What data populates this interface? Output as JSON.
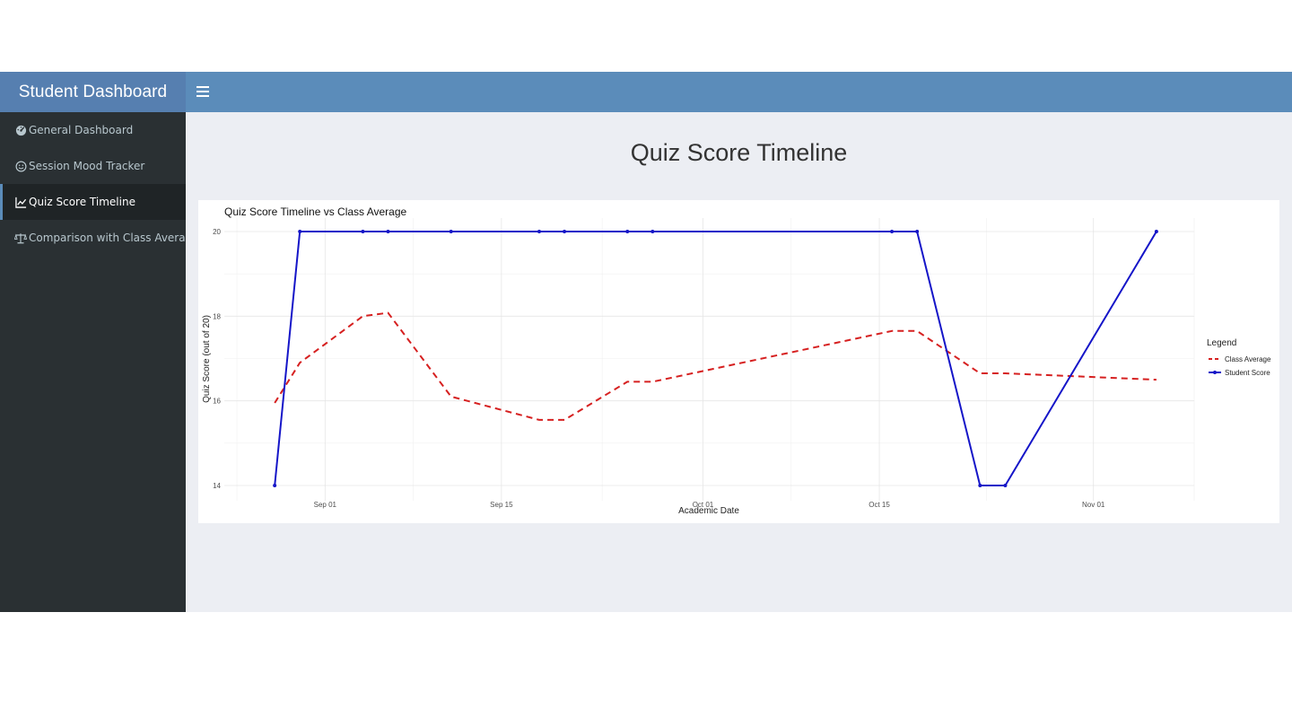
{
  "app": {
    "brand": "Student Dashboard",
    "header_color": "#5b8cba",
    "sidebar_color": "#2a3033"
  },
  "sidebar": {
    "items": [
      {
        "label": "General Dashboard",
        "icon": "tachometer-icon",
        "active": false
      },
      {
        "label": "Session Mood Tracker",
        "icon": "smile-icon",
        "active": false
      },
      {
        "label": "Quiz Score Timeline",
        "icon": "line-chart-icon",
        "active": true
      },
      {
        "label": "Comparison with Class Average",
        "icon": "balance-scale-icon",
        "active": false
      }
    ]
  },
  "main": {
    "page_title": "Quiz Score Timeline"
  },
  "chart_data": {
    "type": "line",
    "title": "Quiz Score Timeline vs Class Average",
    "xlabel": "Academic Date",
    "ylabel": "Quiz Score (out of 20)",
    "ylim": [
      14,
      20
    ],
    "xlim": [
      "2025-08-24",
      "2025-11-09"
    ],
    "y_ticks": [
      14,
      16,
      18,
      20
    ],
    "x_ticks": [
      {
        "date": "2025-09-01",
        "label": "Sep 01"
      },
      {
        "date": "2025-09-15",
        "label": "Sep 15"
      },
      {
        "date": "2025-10-01",
        "label": "Oct 01"
      },
      {
        "date": "2025-10-15",
        "label": "Oct 15"
      },
      {
        "date": "2025-11-01",
        "label": "Nov 01"
      }
    ],
    "grid": true,
    "legend": {
      "title": "Legend",
      "position": "right"
    },
    "series": [
      {
        "name": "Class Average",
        "color": "#d62020",
        "style": "dashed",
        "markers": false,
        "points": [
          [
            "2025-08-28",
            15.95
          ],
          [
            "2025-08-30",
            16.9
          ],
          [
            "2025-09-04",
            18.0
          ],
          [
            "2025-09-06",
            18.08
          ],
          [
            "2025-09-11",
            16.1
          ],
          [
            "2025-09-18",
            15.55
          ],
          [
            "2025-09-20",
            15.55
          ],
          [
            "2025-09-25",
            16.45
          ],
          [
            "2025-09-27",
            16.45
          ],
          [
            "2025-10-16",
            17.65
          ],
          [
            "2025-10-18",
            17.65
          ],
          [
            "2025-10-23",
            16.65
          ],
          [
            "2025-10-25",
            16.65
          ],
          [
            "2025-11-06",
            16.5
          ]
        ]
      },
      {
        "name": "Student Score",
        "color": "#1515c8",
        "style": "solid",
        "markers": true,
        "points": [
          [
            "2025-08-28",
            14
          ],
          [
            "2025-08-30",
            20
          ],
          [
            "2025-09-04",
            20
          ],
          [
            "2025-09-06",
            20
          ],
          [
            "2025-09-11",
            20
          ],
          [
            "2025-09-18",
            20
          ],
          [
            "2025-09-20",
            20
          ],
          [
            "2025-09-25",
            20
          ],
          [
            "2025-09-27",
            20
          ],
          [
            "2025-10-16",
            20
          ],
          [
            "2025-10-18",
            20
          ],
          [
            "2025-10-23",
            14
          ],
          [
            "2025-10-25",
            14
          ],
          [
            "2025-11-06",
            20
          ]
        ]
      }
    ]
  }
}
